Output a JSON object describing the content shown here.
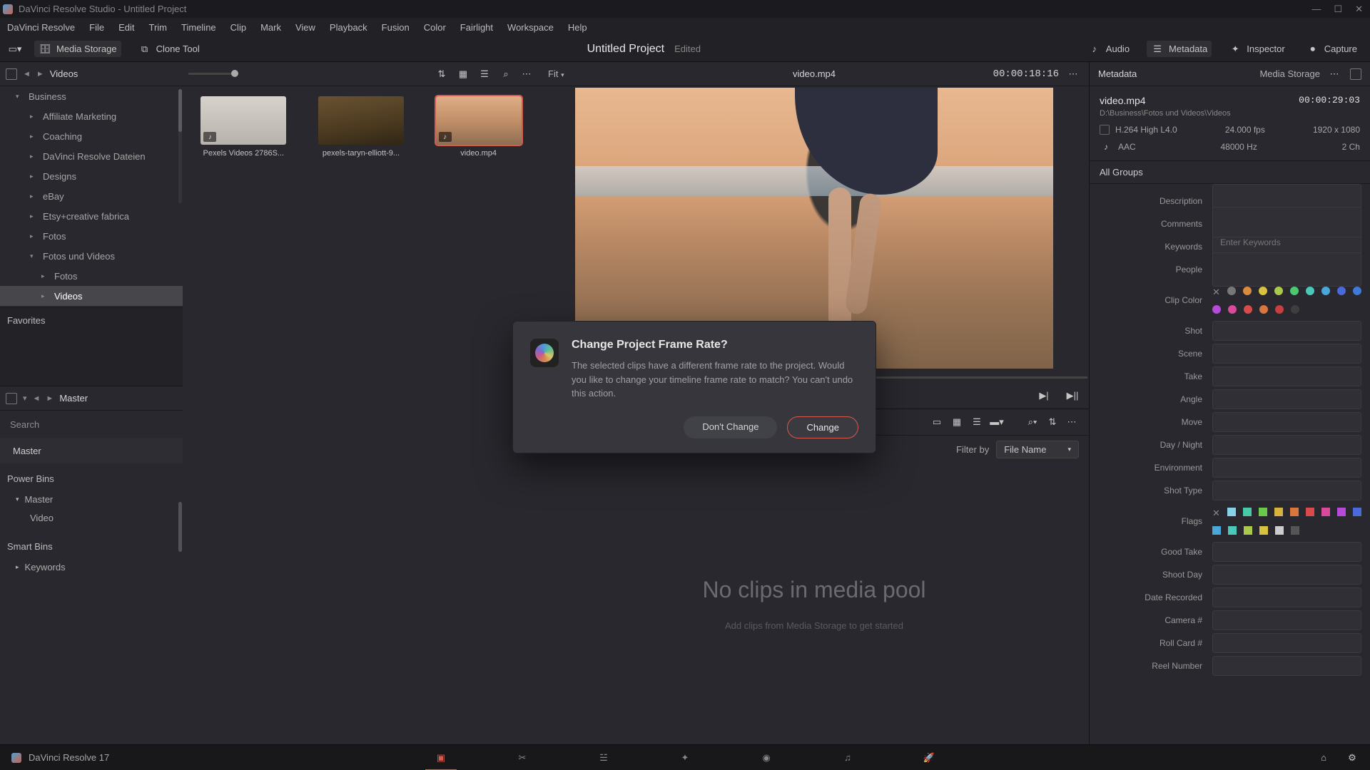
{
  "titlebar": {
    "app": "DaVinci Resolve Studio",
    "project": "Untitled Project"
  },
  "menu": [
    "DaVinci Resolve",
    "File",
    "Edit",
    "Trim",
    "Timeline",
    "Clip",
    "Mark",
    "View",
    "Playback",
    "Fusion",
    "Color",
    "Fairlight",
    "Workspace",
    "Help"
  ],
  "toolbar": {
    "mediaStorage": "Media Storage",
    "cloneTool": "Clone Tool",
    "project": "Untitled Project",
    "edited": "Edited",
    "audio": "Audio",
    "metadata": "Metadata",
    "inspector": "Inspector",
    "capture": "Capture"
  },
  "leftPanel": {
    "title": "Videos"
  },
  "tree": [
    {
      "label": "Business",
      "exp": true,
      "indent": 0
    },
    {
      "label": "Affiliate Marketing",
      "indent": 1
    },
    {
      "label": "Coaching",
      "indent": 1
    },
    {
      "label": "DaVinci Resolve Dateien",
      "indent": 1
    },
    {
      "label": "Designs",
      "indent": 1
    },
    {
      "label": "eBay",
      "indent": 1
    },
    {
      "label": "Etsy+creative fabrica",
      "indent": 1
    },
    {
      "label": "Fotos",
      "indent": 1
    },
    {
      "label": "Fotos und Videos",
      "exp": true,
      "indent": 1
    },
    {
      "label": "Fotos",
      "indent": 2
    },
    {
      "label": "Videos",
      "indent": 2,
      "active": true
    }
  ],
  "favorites": "Favorites",
  "master": {
    "title": "Master",
    "search": "Search",
    "masterRow": "Master"
  },
  "powerbins": {
    "title": "Power Bins",
    "items": [
      "Master",
      "Video"
    ]
  },
  "smartbins": {
    "title": "Smart Bins",
    "items": [
      "Keywords"
    ]
  },
  "thumbs": [
    {
      "cap": "Pexels Videos 2786S...",
      "music": true,
      "bg": "bg-a"
    },
    {
      "cap": "pexels-taryn-elliott-9...",
      "music": false,
      "bg": "bg-b"
    },
    {
      "cap": "video.mp4",
      "music": true,
      "bg": "bg-c",
      "sel": true
    }
  ],
  "viewer": {
    "fit": "Fit",
    "clip": "video.mp4",
    "tc": "00:00:18:16"
  },
  "pool": {
    "noClips": "No clips in media pool",
    "hint": "Add clips from Media Storage to get started",
    "filterBy": "Filter by",
    "filterVal": "File Name"
  },
  "meta": {
    "panel": "Metadata",
    "storage": "Media Storage",
    "file": "video.mp4",
    "tc": "00:00:29:03",
    "path": "D:\\Business\\Fotos und Videos\\Videos",
    "codec": "H.264 High L4.0",
    "fps": "24.000 fps",
    "res": "1920 x 1080",
    "acodec": "AAC",
    "arate": "48000 Hz",
    "ach": "2 Ch",
    "allGroups": "All Groups",
    "labels": {
      "description": "Description",
      "comments": "Comments",
      "keywords": "Keywords",
      "people": "People",
      "clipColor": "Clip Color",
      "shot": "Shot",
      "scene": "Scene",
      "take": "Take",
      "angle": "Angle",
      "move": "Move",
      "dayNight": "Day / Night",
      "environment": "Environment",
      "shotType": "Shot Type",
      "flags": "Flags",
      "goodTake": "Good Take",
      "shootDay": "Shoot Day",
      "dateRecorded": "Date Recorded",
      "cameraNo": "Camera #",
      "rollCard": "Roll Card #",
      "reel": "Reel Number"
    },
    "kwPlaceholder": "Enter Keywords"
  },
  "clipColors": [
    "#777777",
    "#d98b3e",
    "#d9c23e",
    "#a8c94a",
    "#4ac96e",
    "#4ac9b8",
    "#4aa7d9",
    "#4a6ad9",
    "#3e7bd9",
    "#b74ad9",
    "#d94a9a",
    "#d94a4a",
    "#d9763e",
    "#c93e3e",
    "#3e3e3e"
  ],
  "flags": [
    "#88d0e8",
    "#48c9a8",
    "#6ac94a",
    "#d9b23e",
    "#d9763e",
    "#d94a4a",
    "#d94a9a",
    "#b74ad9",
    "#4a6ad9",
    "#4aa7d9",
    "#4ac9b8",
    "#a8c94a",
    "#d9c23e",
    "#cccccc",
    "#555555"
  ],
  "dialog": {
    "title": "Change Project Frame Rate?",
    "body": "The selected clips have a different frame rate to the project. Would you like to change your timeline frame rate to match? You can't undo this action.",
    "dont": "Don't Change",
    "change": "Change"
  },
  "bottom": {
    "app": "DaVinci Resolve 17"
  }
}
